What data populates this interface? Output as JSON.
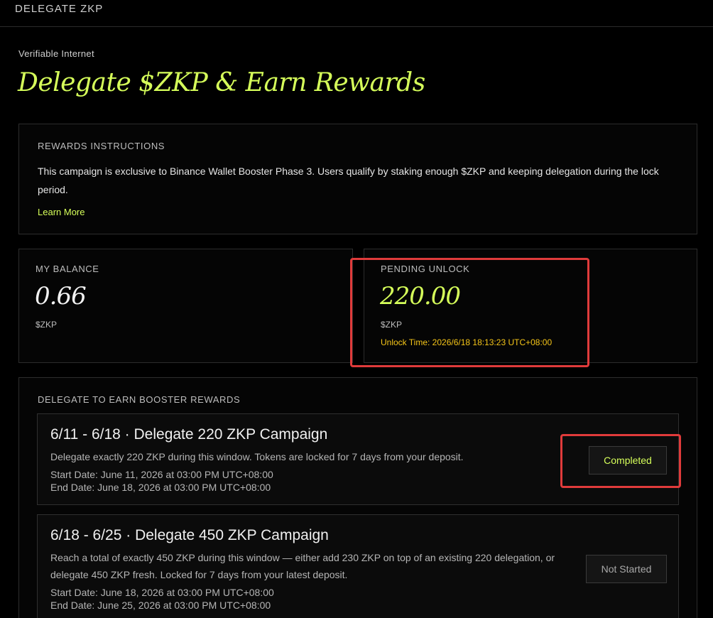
{
  "header": {
    "title": "DELEGATE ZKP"
  },
  "hero": {
    "eyebrow": "Verifiable Internet",
    "title": "Delegate $ZKP & Earn Rewards"
  },
  "instructions": {
    "heading": "REWARDS INSTRUCTIONS",
    "body": "This campaign is exclusive to Binance Wallet Booster Phase 3. Users qualify by staking enough $ZKP and keeping delegation during the lock period.",
    "link": "Learn More"
  },
  "balance": {
    "label": "MY BALANCE",
    "value": "0.66",
    "unit": "$ZKP"
  },
  "pending": {
    "label": "PENDING UNLOCK",
    "value": "220.00",
    "unit": "$ZKP",
    "unlock_time": "Unlock Time: 2026/6/18 18:13:23 UTC+08:00"
  },
  "delegate": {
    "heading": "DELEGATE TO EARN BOOSTER REWARDS",
    "campaigns": [
      {
        "title": "6/11 - 6/18 · Delegate 220 ZKP Campaign",
        "description": "Delegate exactly 220 ZKP during this window. Tokens are locked for 7 days from your deposit.",
        "start": "Start Date: June 11, 2026 at 03:00 PM UTC+08:00",
        "end": "End Date: June 18, 2026 at 03:00 PM UTC+08:00",
        "status": "Completed"
      },
      {
        "title": "6/18 - 6/25 · Delegate 450 ZKP Campaign",
        "description": "Reach a total of exactly 450 ZKP during this window — either add 230 ZKP on top of an existing 220 delegation, or delegate 450 ZKP fresh. Locked for 7 days from your latest deposit.",
        "start": "Start Date: June 18, 2026 at 03:00 PM UTC+08:00",
        "end": "End Date: June 25, 2026 at 03:00 PM UTC+08:00",
        "status": "Not Started"
      }
    ]
  },
  "colors": {
    "accent": "#d6ff5a",
    "warning": "#f5c518",
    "highlight": "#e03b3b",
    "background": "#000000"
  }
}
